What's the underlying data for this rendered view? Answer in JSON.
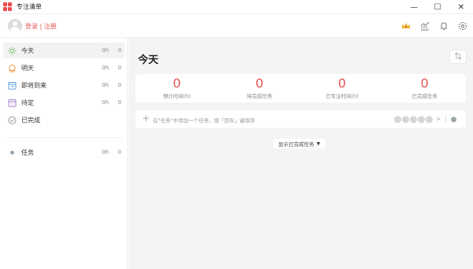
{
  "window": {
    "title": "专注清单",
    "minimize_glyph": "—",
    "maximize_glyph": "☐",
    "close_glyph": "✕"
  },
  "header": {
    "login_text": "登录 | 注册"
  },
  "sidebar": {
    "items": [
      {
        "label": "今天",
        "time": "0h",
        "count": "0",
        "icon": "sun-icon",
        "color": "#7dbb6a"
      },
      {
        "label": "明天",
        "time": "0h",
        "count": "0",
        "icon": "sunrise-icon",
        "color": "#f0a050"
      },
      {
        "label": "即将到来",
        "time": "0h",
        "count": "0",
        "icon": "upcoming-calendar-icon",
        "color": "#5aa0e0"
      },
      {
        "label": "待定",
        "time": "0h",
        "count": "0",
        "icon": "pending-calendar-icon",
        "color": "#a080d0"
      },
      {
        "label": "已完成",
        "icon": "check-circle-icon",
        "color": "#9a9a9a"
      }
    ],
    "projects": [
      {
        "label": "任务",
        "time": "0h",
        "count": "0",
        "color": "#9aa7b0"
      }
    ]
  },
  "main": {
    "title": "今天",
    "stats": [
      {
        "value": "0",
        "label": "预计时间(h)"
      },
      {
        "value": "0",
        "label": "待完成任务"
      },
      {
        "value": "0",
        "label": "已专注时间(h)"
      },
      {
        "value": "0",
        "label": "已完成任务"
      }
    ],
    "add_task_placeholder": "在\"任务\"中添加一个任务，按「回车」键保存",
    "pomodoro_count": 5,
    "show_completed_label": "显示已完成任务",
    "accent_color": "#e65454"
  }
}
